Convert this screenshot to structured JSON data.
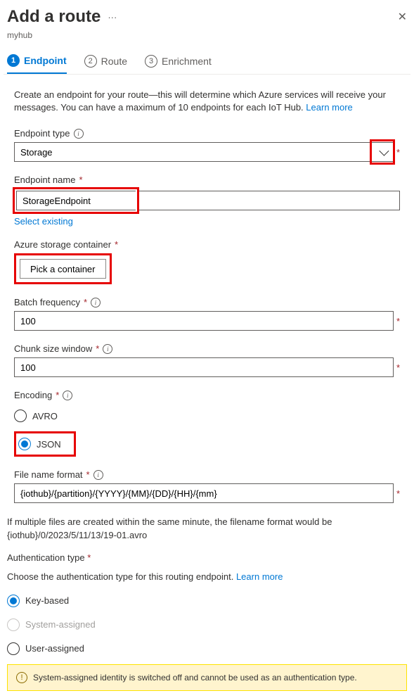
{
  "header": {
    "title": "Add a route",
    "subtitle": "myhub"
  },
  "stepper": {
    "steps": [
      {
        "num": "1",
        "label": "Endpoint",
        "active": true
      },
      {
        "num": "2",
        "label": "Route",
        "active": false
      },
      {
        "num": "3",
        "label": "Enrichment",
        "active": false
      }
    ]
  },
  "intro": {
    "text": "Create an endpoint for your route—this will determine which Azure services will receive your messages. You can have a maximum of 10 endpoints for each IoT Hub. ",
    "link": "Learn more"
  },
  "endpointType": {
    "label": "Endpoint type",
    "value": "Storage"
  },
  "endpointName": {
    "label": "Endpoint name",
    "value": "StorageEndpoint",
    "selectExisting": "Select existing"
  },
  "storageContainer": {
    "label": "Azure storage container",
    "button": "Pick a container"
  },
  "batchFrequency": {
    "label": "Batch frequency",
    "value": "100"
  },
  "chunkSize": {
    "label": "Chunk size window",
    "value": "100"
  },
  "encoding": {
    "label": "Encoding",
    "options": [
      {
        "label": "AVRO",
        "selected": false
      },
      {
        "label": "JSON",
        "selected": true
      }
    ]
  },
  "fileNameFormat": {
    "label": "File name format",
    "value": "{iothub}/{partition}/{YYYY}/{MM}/{DD}/{HH}/{mm}",
    "note": "If multiple files are created within the same minute, the filename format would be {iothub}/0/2023/5/11/13/19-01.avro"
  },
  "authType": {
    "label": "Authentication type",
    "desc": "Choose the authentication type for this routing endpoint. ",
    "link": "Learn more",
    "options": [
      {
        "label": "Key-based",
        "selected": true,
        "disabled": false
      },
      {
        "label": "System-assigned",
        "selected": false,
        "disabled": true
      },
      {
        "label": "User-assigned",
        "selected": false,
        "disabled": false
      }
    ]
  },
  "warning": {
    "text": "System-assigned identity is switched off and cannot be used as an authentication type."
  }
}
